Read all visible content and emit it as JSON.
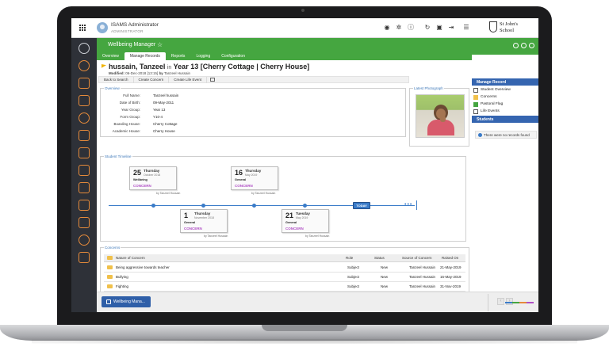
{
  "user": {
    "name": "ISAMS Administrator",
    "role": "ADMINISTRATOR"
  },
  "brand": {
    "line1": "St John's",
    "line2": "School",
    "accent": "#45a640",
    "nav_blue": "#3565b0"
  },
  "topbar_icons": [
    "user-circle-icon",
    "gear-icon",
    "info-icon",
    "refresh-icon",
    "lock-icon",
    "logout-icon",
    "menu-icon"
  ],
  "app": {
    "title": "Wellbeing Manager"
  },
  "tabs": [
    "Overview",
    "Manage Records",
    "Reports",
    "Logging",
    "Configuration"
  ],
  "student": {
    "name": "hussain, Tanzeel",
    "in_word": "in",
    "year_group": "Year 13 [Cherry Cottage | Cherry House]",
    "modified_label": "Modified:",
    "modified_value": "06-Dec-2018 [13:15]",
    "modified_by_word": "by",
    "modified_by": "Tanzeel Hussain"
  },
  "actions": [
    "Back to Search",
    "Create Concern",
    "Create Life Event"
  ],
  "overview": {
    "legend": "Overview",
    "rows": [
      {
        "label": "Full Name:",
        "value": "Tanzeel hussain"
      },
      {
        "label": "Date of Birth:",
        "value": "09-May-2011"
      },
      {
        "label": "Year Group:",
        "value": "Year 13"
      },
      {
        "label": "Form Group:",
        "value": "Y10-4"
      },
      {
        "label": "Boarding House:",
        "value": "Cherry Cottage"
      },
      {
        "label": "Academic House:",
        "value": "Cherry House"
      }
    ]
  },
  "photo": {
    "legend": "Latest Photograph"
  },
  "timeline": {
    "legend": "Student Timeline",
    "today": "TODAY",
    "events": [
      {
        "day": "25",
        "weekday": "Thursday",
        "month": "October 2018",
        "type": "Wellbeing",
        "tag": "CONCERN",
        "by": "by Tanzeel Hussain"
      },
      {
        "day": "16",
        "weekday": "Thursday",
        "month": "May 2019",
        "type": "General",
        "tag": "CONCERN",
        "by": "by Tanzeel Hussain"
      },
      {
        "day": "1",
        "weekday": "Thursday",
        "month": "November 2018",
        "type": "General",
        "tag": "CONCERN",
        "by": "by Tanzeel Hussain"
      },
      {
        "day": "21",
        "weekday": "Tuesday",
        "month": "May 2019",
        "type": "General",
        "tag": "CONCERN",
        "by": "by Tanzeel Hussain"
      }
    ]
  },
  "concerns": {
    "legend": "Concerns",
    "columns": [
      "Nature of Concern",
      "Role",
      "Status",
      "Source of Concern",
      "Raised On"
    ],
    "rows": [
      [
        "Being aggressive towards teacher",
        "Subject",
        "New",
        "Tanzeel Hussain",
        "21-May-2019"
      ],
      [
        "Bullying",
        "Subject",
        "New",
        "Tanzeel Hussain",
        "16-May-2019"
      ],
      [
        "Fighting",
        "Subject",
        "New",
        "Tanzeel Hussain",
        "31-Nov-2019"
      ]
    ]
  },
  "right_panel": {
    "manage_title": "Manage Record",
    "items": [
      "Student Overview",
      "Concerns",
      "Pastoral Flag",
      "Life Events"
    ],
    "students_title": "Students",
    "empty_message": "There were no records found"
  },
  "taskbar": {
    "button_label": "Wellbeing Mana..."
  }
}
